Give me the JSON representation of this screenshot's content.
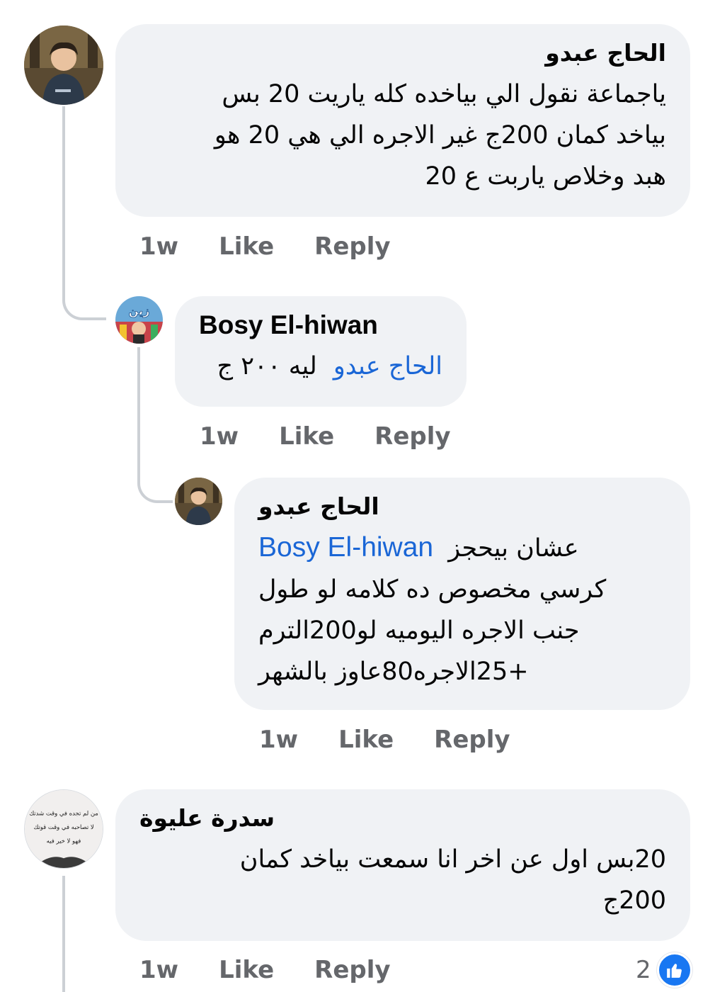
{
  "comments": [
    {
      "author": "الحاج عبدو",
      "lines": [
        "ياجماعة نقول الي بياخده كله ياريت 20 بس",
        "بياخد كمان 200ج غير الاجره الي هي 20 هو",
        "هبد وخلاص ياربت ع 20"
      ],
      "time": "1w",
      "like_label": "Like",
      "reply_label": "Reply"
    },
    {
      "author": "Bosy El-hiwan",
      "mention": "الحاج عبدو",
      "text": "ليه ٢٠٠ ج",
      "time": "1w",
      "like_label": "Like",
      "reply_label": "Reply"
    },
    {
      "author": "الحاج عبدو",
      "mention": "Bosy El-hiwan",
      "first_line": "عشان بيحجز",
      "lines": [
        "كرسي مخصوص ده كلامه لو طول",
        "جنب الاجره اليوميه لو200الترم",
        "+25الاجره80عاوز بالشهر"
      ],
      "time": "1w",
      "like_label": "Like",
      "reply_label": "Reply"
    },
    {
      "author": "سدرة عليوة",
      "lines": [
        "20بس اول عن اخر انا سمعت بياخد كمان",
        "200ج"
      ],
      "time": "1w",
      "like_label": "Like",
      "reply_label": "Reply",
      "reaction_count": "2"
    }
  ],
  "avatar_texts": {
    "zain_logo": "زين",
    "quote_lines": [
      "من لم تجده في وقت شدتك",
      "لا تصاحبه في وقت قوتك",
      "فهو لا خير فيه"
    ]
  },
  "colors": {
    "bubble": "#f0f2f5",
    "meta": "#65676b",
    "mention": "#1a66d6",
    "like_blue": "#1877f2",
    "thread_line": "#ccd0d5"
  },
  "icons": [
    "thumbs-up-icon"
  ]
}
